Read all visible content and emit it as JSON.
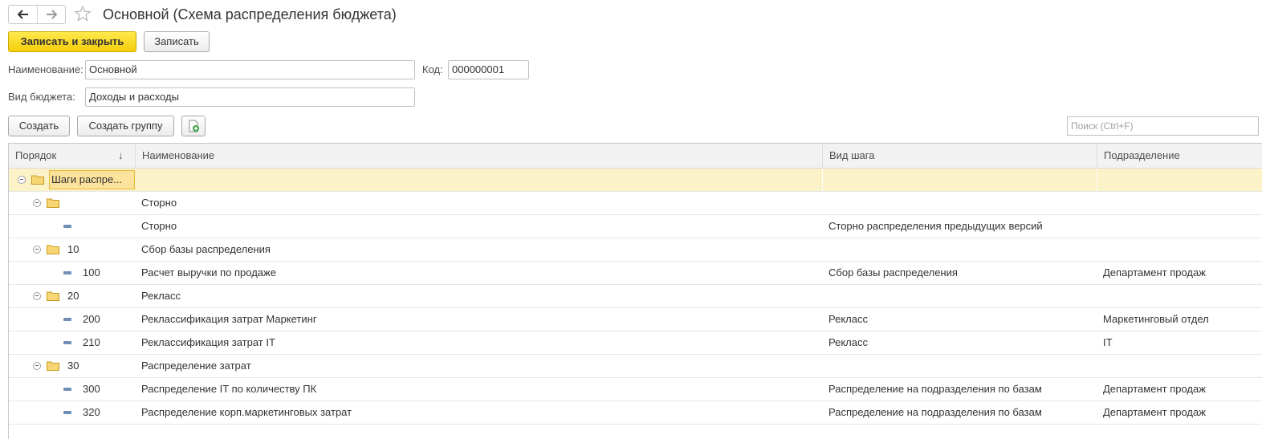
{
  "window": {
    "title": "Основной (Схема распределения бюджета)"
  },
  "toolbar": {
    "save_close_label": "Записать и закрыть",
    "save_label": "Записать"
  },
  "form": {
    "name_label": "Наименование:",
    "name_value": "Основной",
    "code_label": "Код:",
    "code_value": "000000001",
    "budget_type_label": "Вид бюджета:",
    "budget_type_value": "Доходы и расходы"
  },
  "list_toolbar": {
    "create_label": "Создать",
    "create_group_label": "Создать группу",
    "search_placeholder": "Поиск (Ctrl+F)"
  },
  "table": {
    "columns": [
      "Порядок",
      "Наименование",
      "Вид шага",
      "Подразделение"
    ],
    "sort_indicator": "↓",
    "rows": [
      {
        "order": "Шаги распре...",
        "name": "",
        "step_type": "",
        "department": ""
      },
      {
        "order": "",
        "name": "Сторно",
        "step_type": "",
        "department": ""
      },
      {
        "order": "",
        "name": "Сторно",
        "step_type": "Сторно распределения предыдущих версий",
        "department": ""
      },
      {
        "order": "10",
        "name": "Сбор базы распределения",
        "step_type": "",
        "department": ""
      },
      {
        "order": "100",
        "name": "Расчет выручки по продаже",
        "step_type": "Сбор базы распределения",
        "department": "Департамент продаж"
      },
      {
        "order": "20",
        "name": "Реклacc",
        "step_type": "",
        "department": ""
      },
      {
        "order": "200",
        "name": "Реклассификация затрат Маркетинг",
        "step_type": "Реклacc",
        "department": "Маркетинговый отдел"
      },
      {
        "order": "210",
        "name": "Реклассификация затрат IT",
        "step_type": "Реклacc",
        "department": "IT"
      },
      {
        "order": "30",
        "name": "Распределение затрат",
        "step_type": "",
        "department": ""
      },
      {
        "order": "300",
        "name": "Распределение IT по количеству ПК",
        "step_type": "Распределение на подразделения по базам",
        "department": "Департамент продаж"
      },
      {
        "order": "320",
        "name": "Распределение корп.маркетинговых затрат",
        "step_type": "Распределение на подразделения по базам",
        "department": "Департамент продаж"
      }
    ]
  },
  "icons": {
    "back": "arrow-left-icon",
    "forward": "arrow-right-icon",
    "favorite": "star-icon",
    "add_from_file": "document-add-icon",
    "folder": "folder-icon",
    "item": "item-dash-icon",
    "collapse": "collapse-circle-icon"
  },
  "colors": {
    "primary_button": "#f4cd0a",
    "selected_row": "#fbf2c8",
    "folder": "#f2c94c"
  }
}
